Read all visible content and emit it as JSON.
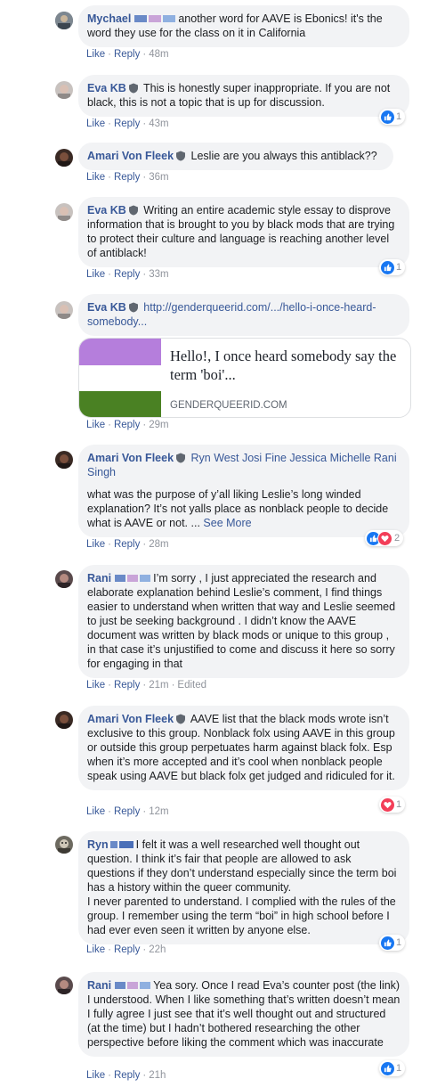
{
  "labels": {
    "like": "Like",
    "reply": "Reply",
    "edited": "Edited",
    "see_more": "See More"
  },
  "comments": [
    {
      "author": "Mychael",
      "text": "another word for AAVE is Ebonics! it's the word they use for the class on it in California",
      "time": "48m"
    },
    {
      "author": "Eva KB",
      "text": "This is honestly super inappropriate. If you are not black, this is not a topic that is up for discussion.",
      "time": "43m",
      "reaction_count": "1"
    },
    {
      "author": "Amari Von Fleek",
      "text": "Leslie are you always this antiblack??",
      "time": "36m"
    },
    {
      "author": "Eva KB",
      "text": "Writing an entire academic style essay to disprove information that is brought to you by black mods that are trying to protect their culture and language is reaching another level of antiblack!",
      "time": "33m",
      "reaction_count": "1"
    },
    {
      "author": "Eva KB",
      "text": "http://genderqueerid.com/.../hello-i-once-heard-somebody...",
      "time": "29m",
      "link_card": {
        "title": "Hello!, I once heard somebody say the term 'boi'...",
        "domain": "GENDERQUEERID.COM"
      }
    },
    {
      "author": "Amari Von Fleek",
      "mentions": "Ryn West Josi Fine Jessica Michelle Rani Singh",
      "text": "what was the purpose of y’all liking Leslie’s long winded explanation? It’s not yalls place as nonblack people to decide what is AAVE or not. ...",
      "time": "28m",
      "reaction_count": "2"
    },
    {
      "author": "Rani",
      "text": "I’m sorry , I just appreciated the research and elaborate explanation behind Leslie’s comment, I find things easier to understand when written that way and Leslie seemed to just be seeking background . I didn’t know the AAVE document was written by black mods or unique to this group , in that case it’s unjustified to come and discuss it here so sorry for engaging in that",
      "time": "21m"
    },
    {
      "author": "Amari Von Fleek",
      "text": "AAVE list that the black mods wrote isn’t exclusive to this group. Nonblack folx using AAVE in this group or outside this group perpetuates harm against black folx. Esp when it’s more accepted and it’s cool when nonblack people speak using AAVE but black folx get judged and ridiculed for it.",
      "time": "12m",
      "reaction_count": "1"
    },
    {
      "author": "Ryn",
      "text": "I felt it was a well researched well thought out question. I think it’s fair that people are allowed to ask questions if they don’t understand especially since the term boi has a history within the queer community.",
      "text2": "I never parented to understand. I complied with the rules of the group. I remember using the term “boi” in high school before I had ever even seen it written by anyone else.",
      "time": "22h",
      "reaction_count": "1"
    },
    {
      "author": "Rani",
      "text": "Yea sory. Once I read Eva’s counter post (the link) I understood. When I like something that’s written doesn’t mean I fully agree I just see that it’s well thought out and structured (at the time) but I hadn’t bothered researching the other perspective before liking the comment which was inaccurate",
      "time": "21h",
      "reaction_count": "1"
    }
  ],
  "colors": {
    "link": "#385898",
    "bubble": "#f2f3f5",
    "like": "#1877f2",
    "love": "#f33e58",
    "flag_top": "#b57edc",
    "flag_mid": "#ffffff",
    "flag_bottom": "#4a8123"
  }
}
